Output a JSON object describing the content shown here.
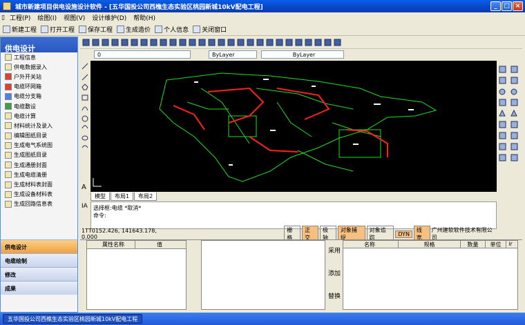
{
  "window": {
    "title": "城市新建项目供电设施设计软件 - [五华国投公司西樵生态实验区桃园新城10kV配电工程]"
  },
  "menu": [
    "工程(P)",
    "绘图(I)",
    "视图(V)",
    "设计维护(D)",
    "帮助(H)"
  ],
  "toolbar": [
    "新建工程",
    "打开工程",
    "保存工程",
    "生成造价",
    "个人信息",
    "关闭窗口"
  ],
  "left_panel": {
    "title": "供电设计",
    "items": [
      "工程信息",
      "供电数据录入",
      "户外开关站",
      "电缆环网箱",
      "电缆分支箱",
      "电缆敷设",
      "电缆计算",
      "材料统计及录入",
      "编辑图纸目录",
      "生成电气系统图",
      "生成图纸目录",
      "生成通册封面",
      "生成电缆清册",
      "生成材料表封面",
      "生成设备材料表",
      "生成回路信息表"
    ],
    "tabs": [
      "供电设计",
      "电缆绘制",
      "修改",
      "成果"
    ]
  },
  "cad": {
    "layer": "0",
    "linetype1": "ByLayer",
    "linetype2": "ByLayer",
    "tabs": [
      "模型",
      "布局1",
      "布局2"
    ],
    "cmd_lines": [
      "选择框:电缆  *取消*",
      "命令:"
    ],
    "coords": "1TT0152.426,  141643.178,  0.000",
    "status_toggles": [
      "栅格",
      "正交",
      "极轴",
      "对象捕捉",
      "对象追踪",
      "DYN",
      "线宽"
    ],
    "company": "广州建软软件技术有限公司"
  },
  "props": {
    "header": [
      "属性名称",
      "值"
    ]
  },
  "actions": [
    "采用",
    "添加",
    "替换"
  ],
  "table": {
    "header": [
      "名称",
      "规格",
      "数量",
      "单位",
      "ir"
    ]
  },
  "taskbar": {
    "item": "五华国投公司西樵生态实验区桃园新城10kV配电工程"
  },
  "colors": {
    "title": "#0846c8",
    "canvas": "#000000",
    "wire_red": "#ff2020",
    "wire_green": "#20e020",
    "taskbar": "#2458d8"
  }
}
